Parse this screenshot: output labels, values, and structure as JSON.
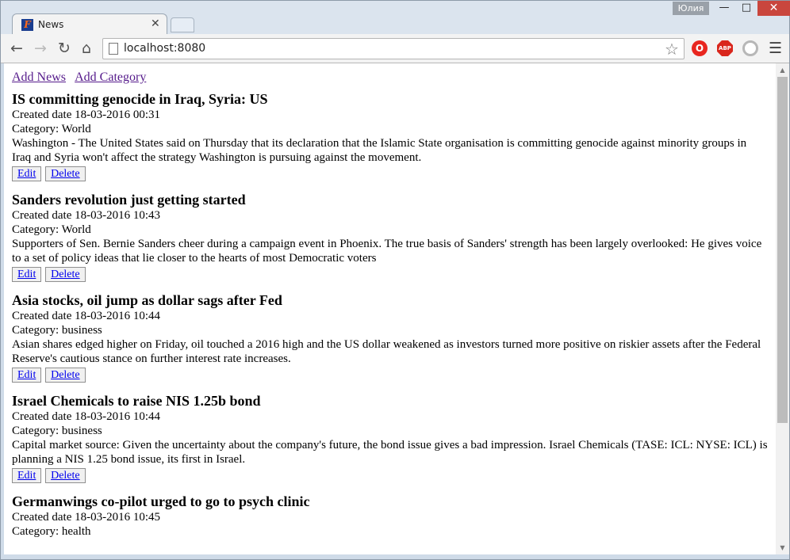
{
  "browser": {
    "tab_title": "News",
    "url": "localhost:8080",
    "user_name": "Юлия",
    "favicon_letter": "F",
    "extensions": {
      "abp_label": "ABP"
    }
  },
  "page": {
    "links": {
      "add_news": "Add News",
      "add_category": "Add Category"
    },
    "actions": {
      "edit": "Edit",
      "delete": "Delete"
    },
    "articles": [
      {
        "title": "IS committing genocide in Iraq, Syria: US",
        "created": "Created date 18-03-2016 00:31",
        "category": "Category: World",
        "description": "Washington - The United States said on Thursday that its declaration that the Islamic State organisation is committing genocide against minority groups in Iraq and Syria won't affect the strategy Washington is pursuing against the movement."
      },
      {
        "title": "Sanders revolution just getting started",
        "created": "Created date 18-03-2016 10:43",
        "category": "Category: World",
        "description": "Supporters of Sen. Bernie Sanders cheer during a campaign event in Phoenix. The true basis of Sanders' strength has been largely overlooked: He gives voice to a set of policy ideas that lie closer to the hearts of most Democratic voters"
      },
      {
        "title": "Asia stocks, oil jump as dollar sags after Fed",
        "created": "Created date 18-03-2016 10:44",
        "category": "Category: business",
        "description": "Asian shares edged higher on Friday, oil touched a 2016 high and the US dollar weakened as investors turned more positive on riskier assets after the Federal Reserve's cautious stance on further interest rate increases."
      },
      {
        "title": "Israel Chemicals to raise NIS 1.25b bond",
        "created": "Created date 18-03-2016 10:44",
        "category": "Category: business",
        "description": "Capital market source: Given the uncertainty about the company's future, the bond issue gives a bad impression. Israel Chemicals (TASE: ICL: NYSE: ICL) is planning a NIS 1.25 bond issue, its first in Israel."
      },
      {
        "title": "Germanwings co-pilot urged to go to psych clinic",
        "created": "Created date 18-03-2016 10:45",
        "category": "Category: health",
        "description": ""
      }
    ]
  }
}
